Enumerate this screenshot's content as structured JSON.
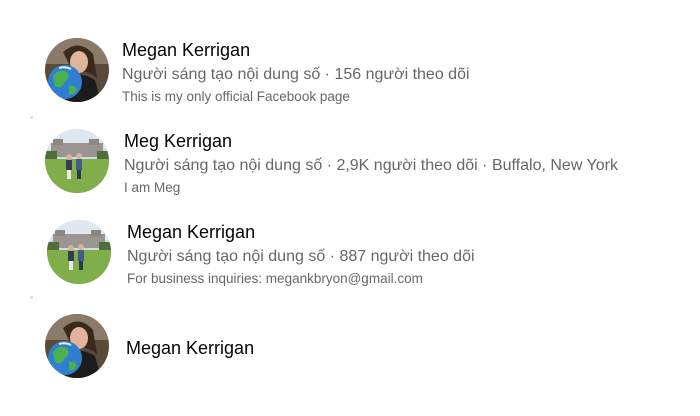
{
  "results": [
    {
      "name": "Megan Kerrigan",
      "meta": "Người sáng tạo nội dung số · 156 người theo dõi",
      "description": "This is my only official Facebook page",
      "avatar_icon": "globe-portrait-avatar"
    },
    {
      "name": "Meg Kerrigan",
      "meta": "Người sáng tạo nội dung số · 2,9K người theo dõi · Buffalo, New York",
      "description": "I am Meg",
      "avatar_icon": "golf-course-couple-avatar"
    },
    {
      "name": "Megan Kerrigan",
      "meta": "Người sáng tạo nội dung số · 887 người theo dõi",
      "description": "For business inquiries: megankbryon@gmail.com",
      "avatar_icon": "golf-course-couple-avatar"
    },
    {
      "name": "Megan Kerrigan",
      "avatar_icon": "globe-portrait-avatar"
    }
  ],
  "colors": {
    "primary_text": "#050505",
    "secondary_text": "#65676b"
  }
}
